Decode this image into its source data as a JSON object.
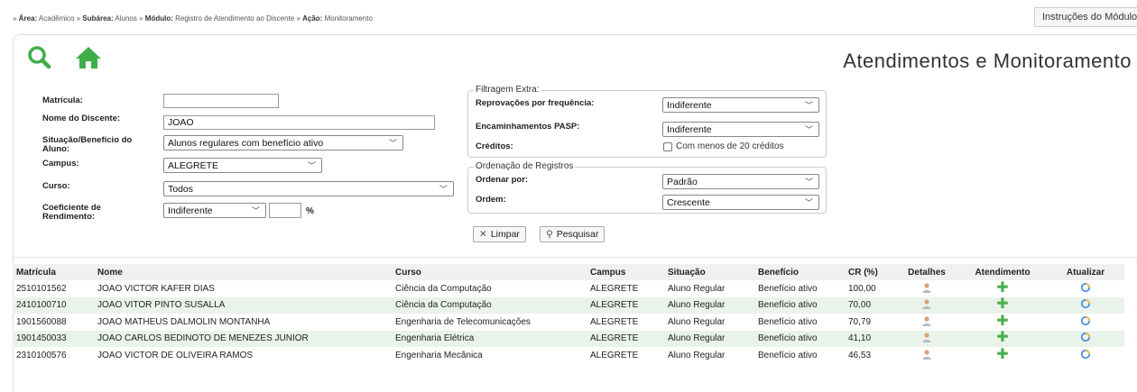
{
  "breadcrumb": {
    "area_label": "Área:",
    "area_value": "Acadêmico",
    "subarea_label": "Subárea:",
    "subarea_value": "Alunos",
    "module_label": "Módulo:",
    "module_value": "Registro de Atendimento ao Discente",
    "action_label": "Ação:",
    "action_value": "Monitoramento"
  },
  "instructions_button": "Instruções do Módulo",
  "page_title": "Atendimentos e Monitoramento",
  "form": {
    "matricula_label": "Matrícula:",
    "matricula_value": "",
    "nome_label": "Nome do Discente:",
    "nome_value": "JOAO",
    "situacao_label": "Situação/Benefício do Aluno:",
    "situacao_value": "Alunos regulares com benefício ativo",
    "campus_label": "Campus:",
    "campus_value": "ALEGRETE",
    "curso_label": "Curso:",
    "curso_value": "Todos",
    "cr_label": "Coeficiente de Rendimento:",
    "cr_value": "Indiferente",
    "cr_number": "",
    "cr_unit": "%"
  },
  "extra": {
    "legend": "Filtragem Extra:",
    "reprovacoes_label": "Reprovações por frequência:",
    "reprovacoes_value": "Indiferente",
    "pasp_label": "Encaminhamentos PASP:",
    "pasp_value": "Indiferente",
    "creditos_label": "Créditos:",
    "creditos_checkbox": "Com menos de 20 créditos"
  },
  "order": {
    "legend": "Ordenação de Registros",
    "ordenar_label": "Ordenar por:",
    "ordenar_value": "Padrão",
    "ordem_label": "Ordem:",
    "ordem_value": "Crescente"
  },
  "buttons": {
    "limpar": "Limpar",
    "pesquisar": "Pesquisar"
  },
  "table": {
    "headers": [
      "Matrícula",
      "Nome",
      "Curso",
      "Campus",
      "Situação",
      "Benefício",
      "CR (%)",
      "Detalhes",
      "Atendimento",
      "Atualizar"
    ],
    "rows": [
      [
        "2510101562",
        "JOAO VICTOR KAFER DIAS",
        "Ciência da Computação",
        "ALEGRETE",
        "Aluno Regular",
        "Benefício ativo",
        "100,00"
      ],
      [
        "2410100710",
        "JOAO VITOR PINTO SUSALLA",
        "Ciência da Computação",
        "ALEGRETE",
        "Aluno Regular",
        "Benefício ativo",
        "70,00"
      ],
      [
        "1901560088",
        "JOAO MATHEUS DALMOLIN MONTANHA",
        "Engenharia de Telecomunicações",
        "ALEGRETE",
        "Aluno Regular",
        "Benefício ativo",
        "70,79"
      ],
      [
        "1901450033",
        "JOAO CARLOS BEDINOTO DE MENEZES JUNIOR",
        "Engenharia Elétrica",
        "ALEGRETE",
        "Aluno Regular",
        "Benefício ativo",
        "41,10"
      ],
      [
        "2310100576",
        "JOAO VICTOR DE OLIVEIRA RAMOS",
        "Engenharia Mecânica",
        "ALEGRETE",
        "Aluno Regular",
        "Benefício ativo",
        "46,53"
      ]
    ]
  },
  "icons": {
    "search": "search-icon",
    "home": "home-icon",
    "details": "user-icon",
    "atendimento": "plus-icon",
    "atualizar": "refresh-icon",
    "clear": "close-icon"
  },
  "colors": {
    "accent_green": "#4caf50",
    "row_alt": "#e9f3ea",
    "header_bg": "#f0f0f0"
  }
}
